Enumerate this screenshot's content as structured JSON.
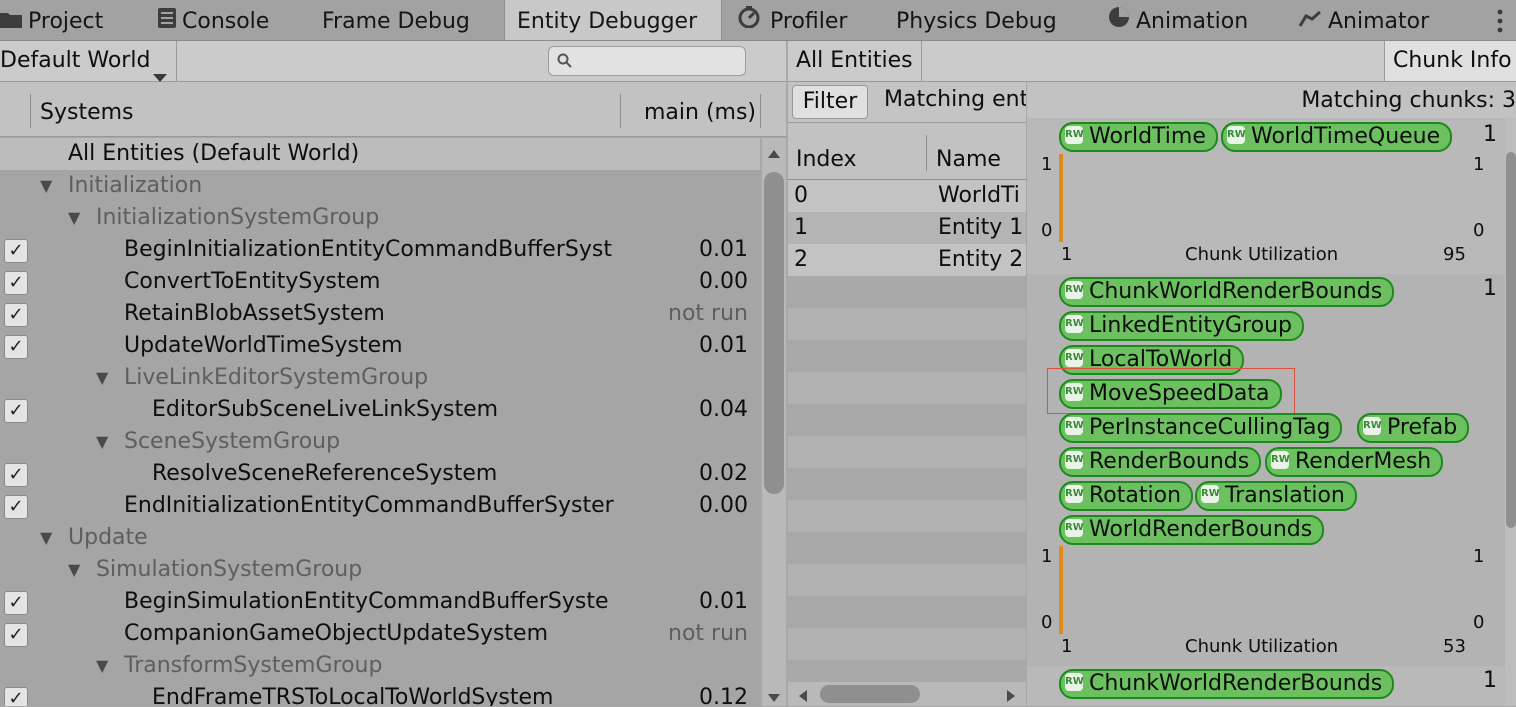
{
  "tabs": [
    {
      "label": "Project",
      "icon": "folder-icon"
    },
    {
      "label": "Console",
      "icon": "console-icon"
    },
    {
      "label": "Frame Debug",
      "icon": ""
    },
    {
      "label": "Entity Debugger",
      "icon": "",
      "active": true
    },
    {
      "label": "Profiler",
      "icon": "profiler-icon"
    },
    {
      "label": "Physics Debug",
      "icon": ""
    },
    {
      "label": "Animation",
      "icon": "animation-icon"
    },
    {
      "label": "Animator",
      "icon": "animator-icon"
    }
  ],
  "left_toolbar": {
    "world_label": "Default World",
    "search_placeholder": ""
  },
  "systems_header": {
    "systems_label": "Systems",
    "timing_label": "main (ms)"
  },
  "systems": [
    {
      "label": "All Entities (Default World)",
      "value": ""
    },
    {
      "label": "Initialization",
      "value": ""
    },
    {
      "label": "InitializationSystemGroup",
      "value": ""
    },
    {
      "label": "BeginInitializationEntityCommandBufferSyst",
      "value": "0.01"
    },
    {
      "label": "ConvertToEntitySystem",
      "value": "0.00"
    },
    {
      "label": "RetainBlobAssetSystem",
      "value": "not run"
    },
    {
      "label": "UpdateWorldTimeSystem",
      "value": "0.01"
    },
    {
      "label": "LiveLinkEditorSystemGroup",
      "value": ""
    },
    {
      "label": "EditorSubSceneLiveLinkSystem",
      "value": "0.04"
    },
    {
      "label": "SceneSystemGroup",
      "value": ""
    },
    {
      "label": "ResolveSceneReferenceSystem",
      "value": "0.02"
    },
    {
      "label": "EndInitializationEntityCommandBufferSyster",
      "value": "0.00"
    },
    {
      "label": "Update",
      "value": ""
    },
    {
      "label": "SimulationSystemGroup",
      "value": ""
    },
    {
      "label": "BeginSimulationEntityCommandBufferSyste",
      "value": "0.01"
    },
    {
      "label": "CompanionGameObjectUpdateSystem",
      "value": "not run"
    },
    {
      "label": "TransformSystemGroup",
      "value": ""
    },
    {
      "label": "EndFrameTRSToLocalToWorldSystem",
      "value": "0.12"
    }
  ],
  "mid": {
    "all_entities_label": "All Entities",
    "filter_label": "Filter",
    "matching_label": "Matching ent",
    "index_header": "Index",
    "name_header": "Name",
    "entities": [
      {
        "index": "0",
        "name": "WorldTi"
      },
      {
        "index": "1",
        "name": "Entity 1"
      },
      {
        "index": "2",
        "name": "Entity 2"
      }
    ]
  },
  "right": {
    "chunk_info_label": "Chunk Info",
    "matching_chunks_label": "Matching chunks: 3",
    "rw_badge": "RW",
    "chunks": [
      {
        "count": "1",
        "tags": [
          "WorldTime",
          "WorldTimeQueue"
        ],
        "y_top": "1",
        "y_bottom": "0",
        "y_top_right": "1",
        "y_bottom_right": "0",
        "x_left": "1",
        "x_right": "95",
        "utilization_label": "Chunk Utilization"
      },
      {
        "count": "1",
        "tags": [
          "ChunkWorldRenderBounds",
          "LinkedEntityGroup",
          "LocalToWorld",
          "MoveSpeedData",
          "PerInstanceCullingTag",
          "Prefab",
          "RenderBounds",
          "RenderMesh",
          "Rotation",
          "Translation",
          "WorldRenderBounds"
        ],
        "y_top": "1",
        "y_bottom": "0",
        "y_top_right": "1",
        "y_bottom_right": "0",
        "x_left": "1",
        "x_right": "53",
        "utilization_label": "Chunk Utilization"
      },
      {
        "count": "1",
        "tags": [
          "ChunkWorldRenderBounds"
        ]
      }
    ]
  },
  "colors": {
    "tag_fill": "#6cc05f",
    "tag_border": "#1d8a1d",
    "highlight": "#e05040",
    "util_bar": "#e08a1a"
  }
}
